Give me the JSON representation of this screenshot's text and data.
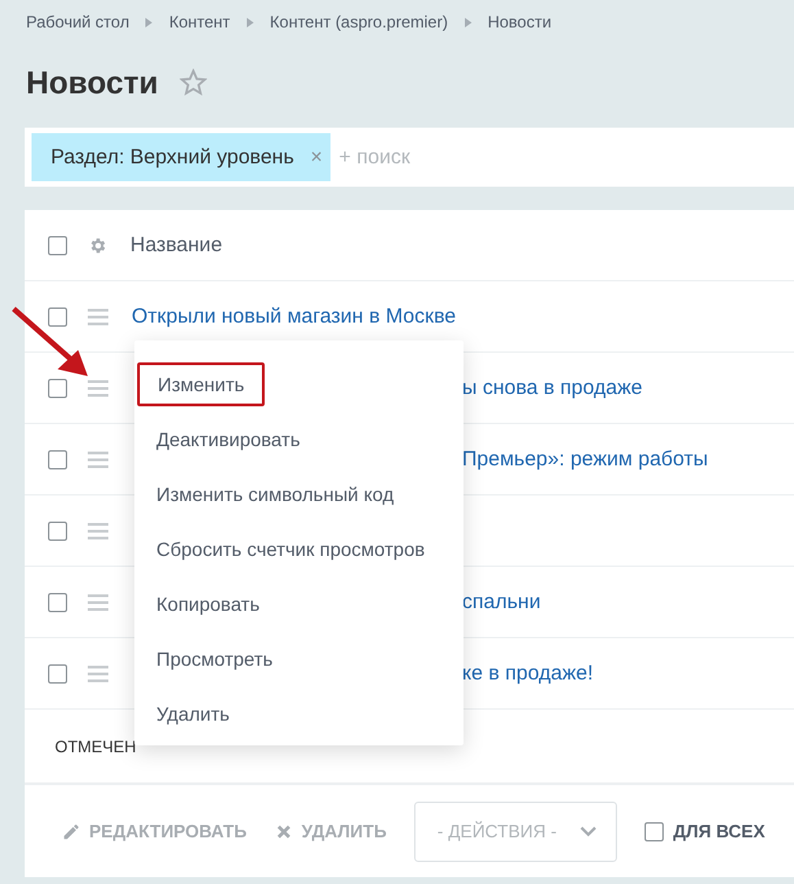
{
  "breadcrumbs": [
    "Рабочий стол",
    "Контент",
    "Контент (aspro.premier)",
    "Новости"
  ],
  "title": "Новости",
  "favorite": false,
  "filter": {
    "tag": "Раздел: Верхний уровень",
    "remove": "×",
    "placeholder": "+ поиск"
  },
  "table": {
    "all_checked": false,
    "columns": [
      "Название"
    ],
    "rows": [
      {
        "title": "Открыли новый магазин в Москве",
        "checked": false
      },
      {
        "title": "ы снова в продаже",
        "checked": false
      },
      {
        "title": "Премьер»: режим работы",
        "checked": false
      },
      {
        "checked": false
      },
      {
        "title": "спальни",
        "checked": false
      },
      {
        "title": "ке в продаже!",
        "checked": false
      }
    ],
    "footer": "ОТМЕЧЕН"
  },
  "context_menu": {
    "items": [
      {
        "label": "Изменить",
        "selected": true
      },
      {
        "label": "Деактивировать",
        "selected": false
      },
      {
        "label": "Изменить символьный код",
        "selected": false
      },
      {
        "label": "Сбросить счетчик просмотров",
        "selected": false
      },
      {
        "label": "Копировать",
        "selected": false
      },
      {
        "label": "Просмотреть",
        "selected": false
      },
      {
        "label": "Удалить",
        "selected": false
      }
    ]
  },
  "toolbar": {
    "edit": "РЕДАКТИРОВАТЬ",
    "delete": "УДАЛИТЬ",
    "actions": "- ДЕЙСТВИЯ -",
    "for_all": {
      "label": "ДЛЯ ВСЕХ",
      "checked": false
    }
  }
}
